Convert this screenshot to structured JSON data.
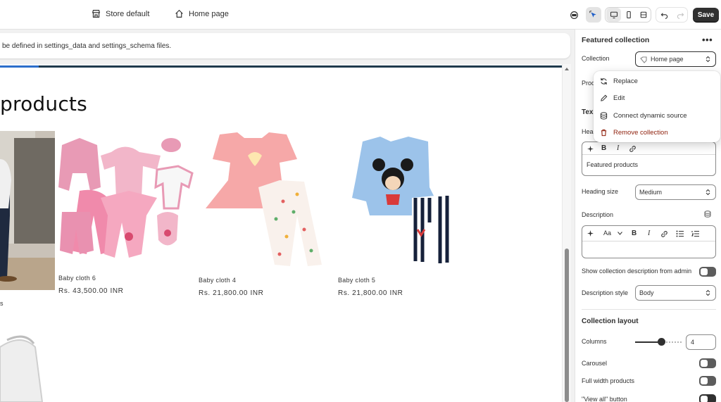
{
  "topbar": {
    "store_label": "Store default",
    "page_label": "Home page",
    "save_label": "Save"
  },
  "notice": {
    "text": "be defined in settings_data and settings_schema files."
  },
  "preview": {
    "section_title": "products",
    "left_card_price_fragment": "s",
    "products": [
      {
        "name": "Baby cloth 6",
        "price": "Rs. 43,500.00 INR"
      },
      {
        "name": "Baby cloth 4",
        "price": "Rs. 21,800.00 INR"
      },
      {
        "name": "Baby cloth 5",
        "price": "Rs. 21,800.00 INR"
      }
    ]
  },
  "panel": {
    "title": "Featured collection",
    "more_label": "•••",
    "collection_label": "Collection",
    "collection_value": "Home page",
    "products_label_partial": "Prod",
    "text_heading_partial": "Tex",
    "heading_label_partial": "Head",
    "heading_value": "Featured products",
    "heading_size_label": "Heading size",
    "heading_size_value": "Medium",
    "description_label": "Description",
    "show_desc_label": "Show collection description from admin",
    "desc_style_label": "Description style",
    "desc_style_value": "Body",
    "layout_heading": "Collection layout",
    "columns_label": "Columns",
    "columns_value": "4",
    "carousel_label": "Carousel",
    "full_width_label": "Full width products",
    "view_all_label": "\"View all\" button",
    "rte_style_label": "Aa"
  },
  "popover": {
    "items": [
      {
        "label": "Replace"
      },
      {
        "label": "Edit"
      },
      {
        "label": "Connect dynamic source"
      },
      {
        "label": "Remove collection"
      }
    ]
  },
  "colors": {
    "danger": "#8e1f0b",
    "save_bg": "#303030",
    "accent_blue": "#2c6ecb"
  }
}
